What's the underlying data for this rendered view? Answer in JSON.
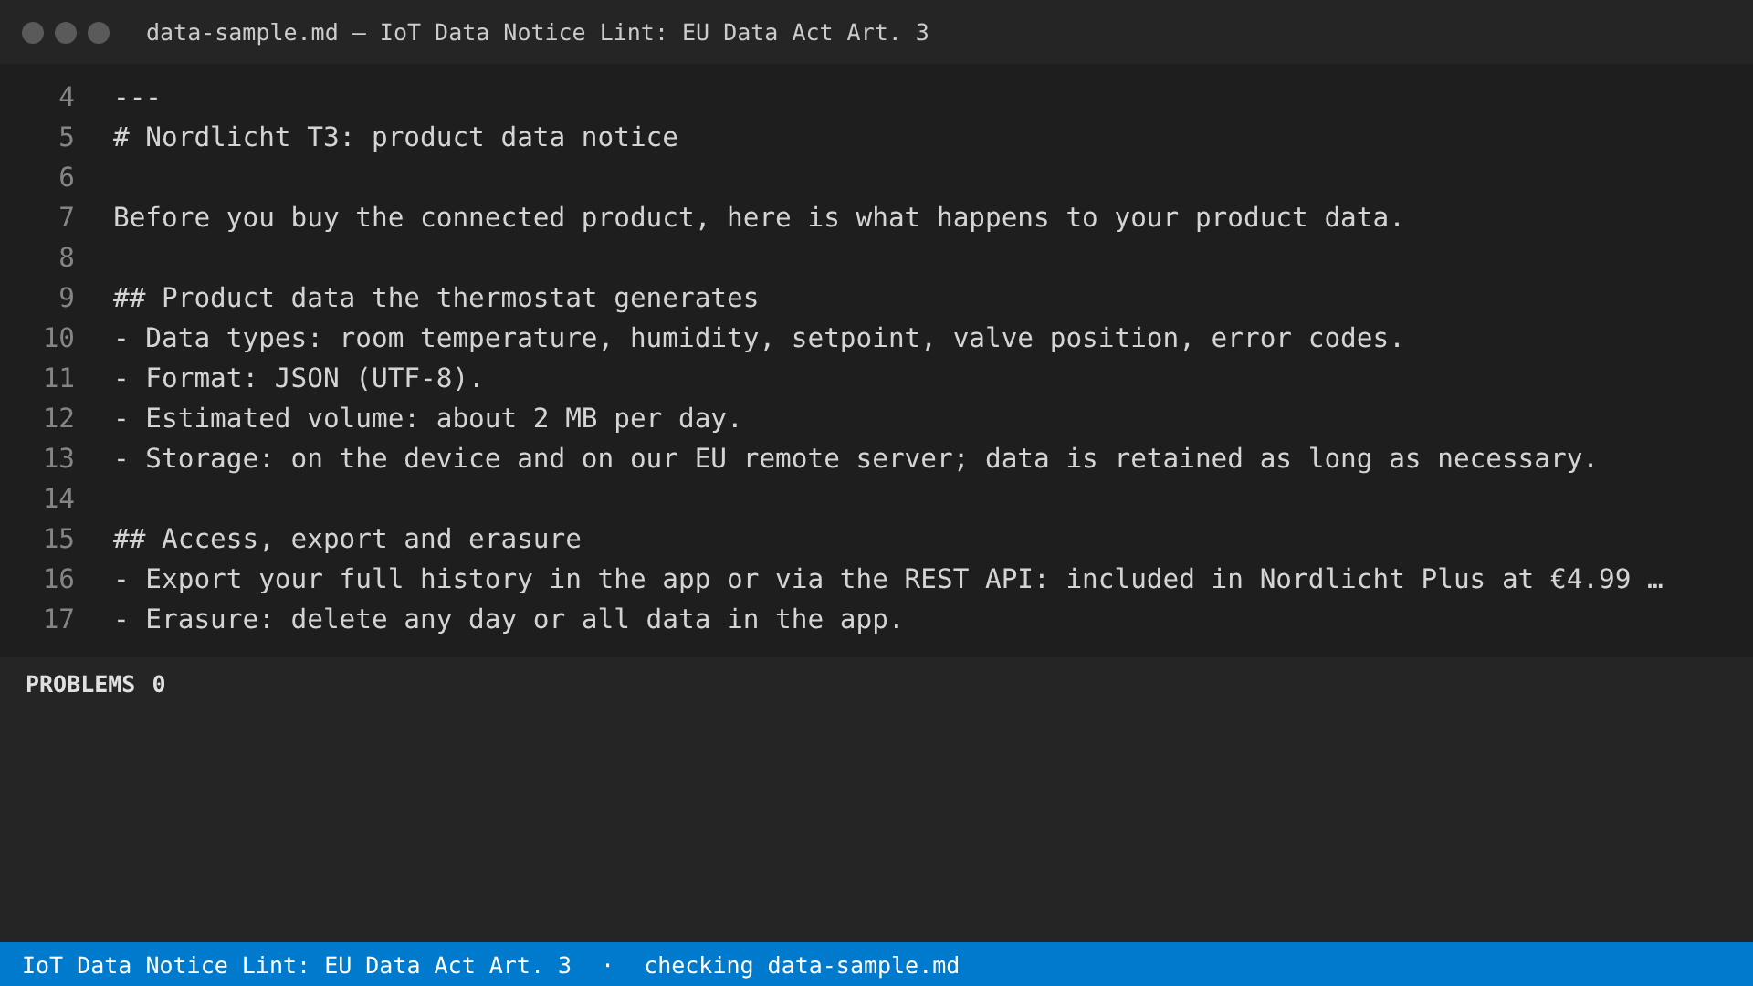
{
  "window": {
    "title": "data-sample.md — IoT Data Notice Lint: EU Data Act Art. 3"
  },
  "editor": {
    "lines": [
      {
        "number": "4",
        "text": "---"
      },
      {
        "number": "5",
        "text": "# Nordlicht T3: product data notice"
      },
      {
        "number": "6"
      },
      {
        "number": "7",
        "text": "Before you buy the connected product, here is what happens to your product data."
      },
      {
        "number": "8"
      },
      {
        "number": "9",
        "text": "## Product data the thermostat generates"
      },
      {
        "number": "10",
        "text": "- Data types: room temperature, humidity, setpoint, valve position, error codes."
      },
      {
        "number": "11",
        "text": "- Format: JSON (UTF-8)."
      },
      {
        "number": "12",
        "text": "- Estimated volume: about 2 MB per day."
      },
      {
        "number": "13",
        "text": "- Storage: on the device and on our EU remote server; data is retained as long as necessary."
      },
      {
        "number": "14"
      },
      {
        "number": "15",
        "text": "## Access, export and erasure"
      },
      {
        "number": "16",
        "text": "- Export your full history in the app or via the REST API: included in Nordlicht Plus at €4.99 …"
      },
      {
        "number": "17",
        "text": "- Erasure: delete any day or all data in the app."
      }
    ]
  },
  "problems_panel": {
    "label": "PROBLEMS",
    "count": "0"
  },
  "status_bar": {
    "items": [
      "IoT Data Notice Lint: EU Data Act Art. 3",
      "·",
      "checking data-sample.md"
    ]
  }
}
